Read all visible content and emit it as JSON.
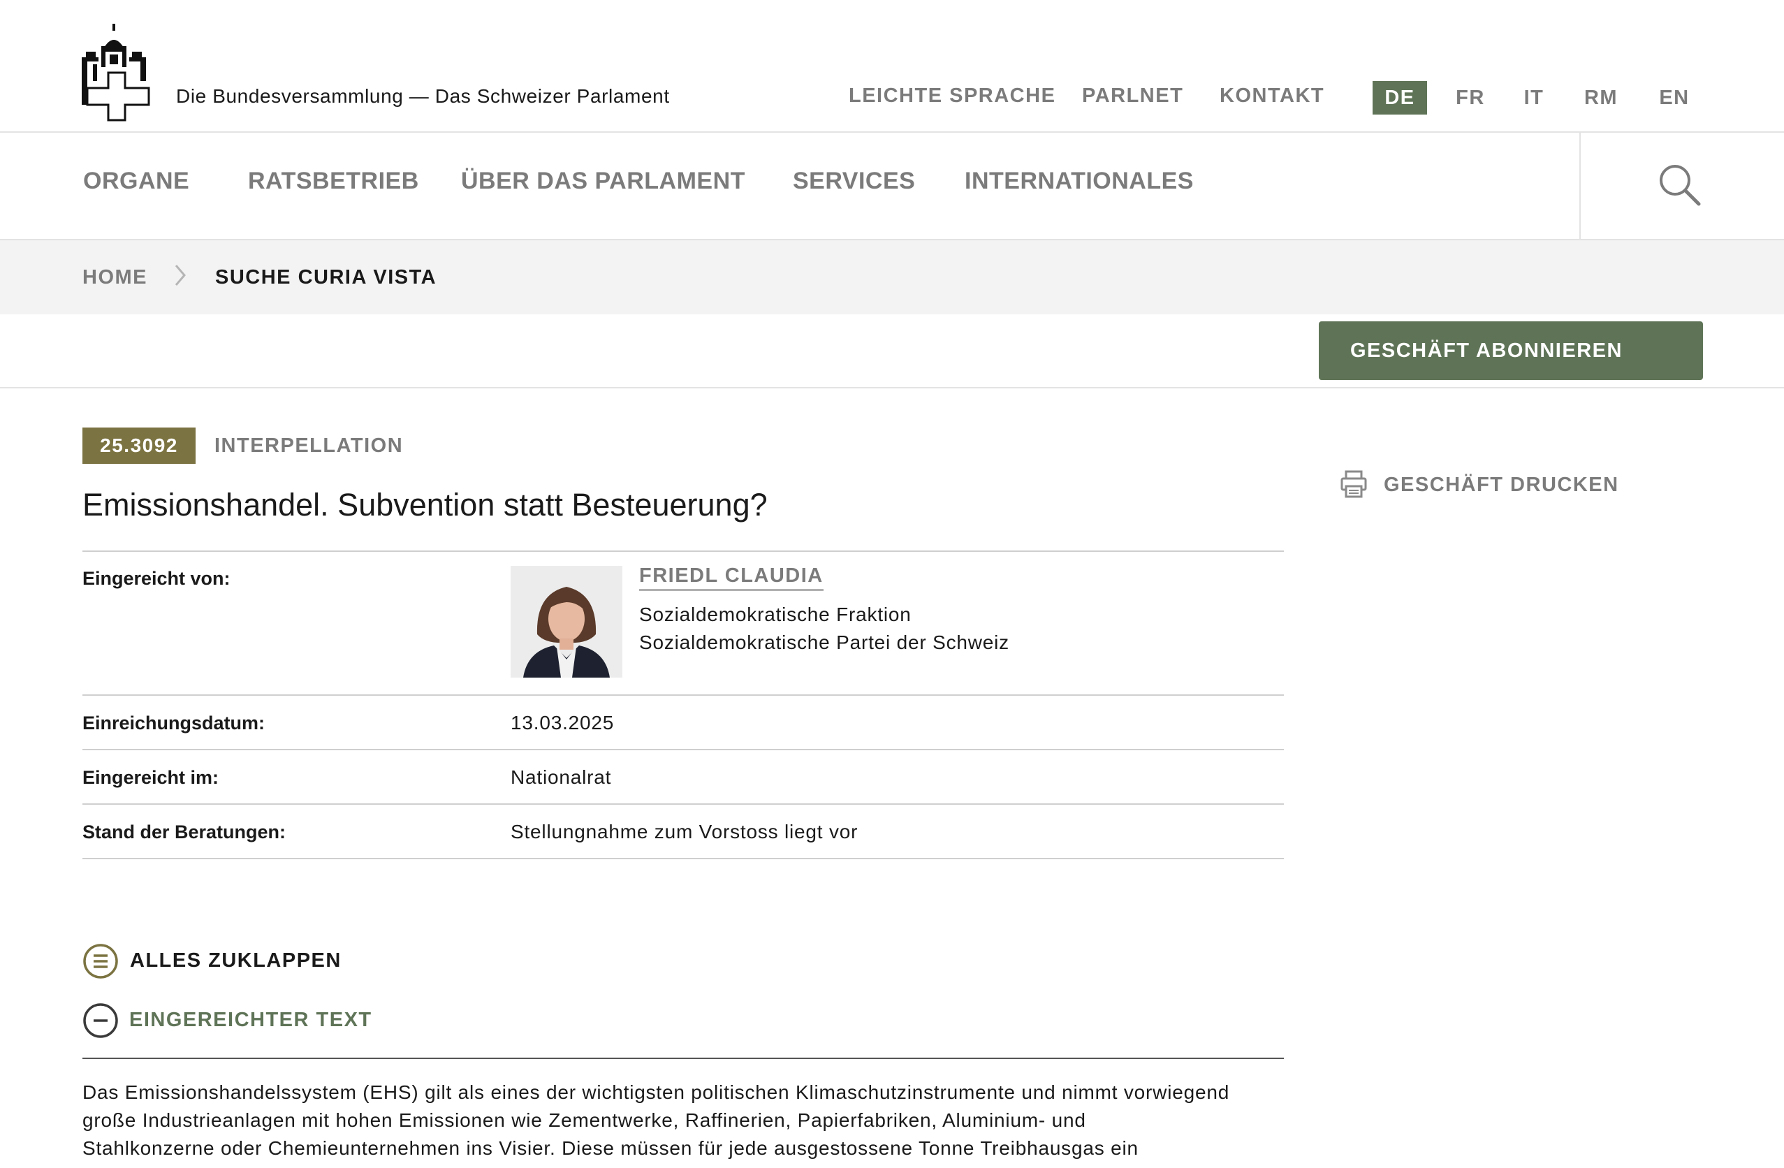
{
  "header": {
    "site_title": "Die Bundesversammlung — Das Schweizer Parlament",
    "top_links": [
      "LEICHTE SPRACHE",
      "PARLNET",
      "KONTAKT"
    ],
    "languages": [
      "DE",
      "FR",
      "IT",
      "RM",
      "EN"
    ],
    "active_language": "DE"
  },
  "nav": {
    "items": [
      "ORGANE",
      "RATSBETRIEB",
      "ÜBER DAS PARLAMENT",
      "SERVICES",
      "INTERNATIONALES"
    ],
    "search_icon": "search-icon"
  },
  "breadcrumb": {
    "home": "HOME",
    "current": "SUCHE CURIA VISTA"
  },
  "actions": {
    "subscribe": "GESCHÄFT ABONNIEREN",
    "print": "GESCHÄFT DRUCKEN"
  },
  "business": {
    "number": "25.3092",
    "type": "INTERPELLATION",
    "title": "Emissionshandel. Subvention statt Besteuerung?"
  },
  "details": {
    "submitted_by_label": "Eingereicht von:",
    "author_name": "FRIEDL CLAUDIA",
    "author_faction": "Sozialdemokratische Fraktion",
    "author_party": "Sozialdemokratische Partei der Schweiz",
    "date_label": "Einreichungsdatum:",
    "date_value": "13.03.2025",
    "council_label": "Eingereicht im:",
    "council_value": "Nationalrat",
    "status_label": "Stand der Beratungen:",
    "status_value": "Stellungnahme zum Vorstoss liegt vor"
  },
  "sections": {
    "collapse_all": "ALLES ZUKLAPPEN",
    "submitted_text": "EINGEREICHTER TEXT"
  },
  "body_text": {
    "line1": "Das Emissionshandelssystem (EHS) gilt als eines der wichtigsten politischen Klimaschutzinstrumente und nimmt vorwiegend",
    "line2": "große Industrieanlagen mit hohen Emissionen wie Zementwerke, Raffinerien, Papierfabriken, Aluminium- und",
    "line3": "Stahlkonzerne oder Chemieunternehmen ins Visier. Diese müssen für jede ausgestossene Tonne Treibhausgas ein"
  },
  "colors": {
    "accent_green": "#5f7457",
    "badge_olive": "#7b7341",
    "muted_text": "#7b7b7b"
  }
}
